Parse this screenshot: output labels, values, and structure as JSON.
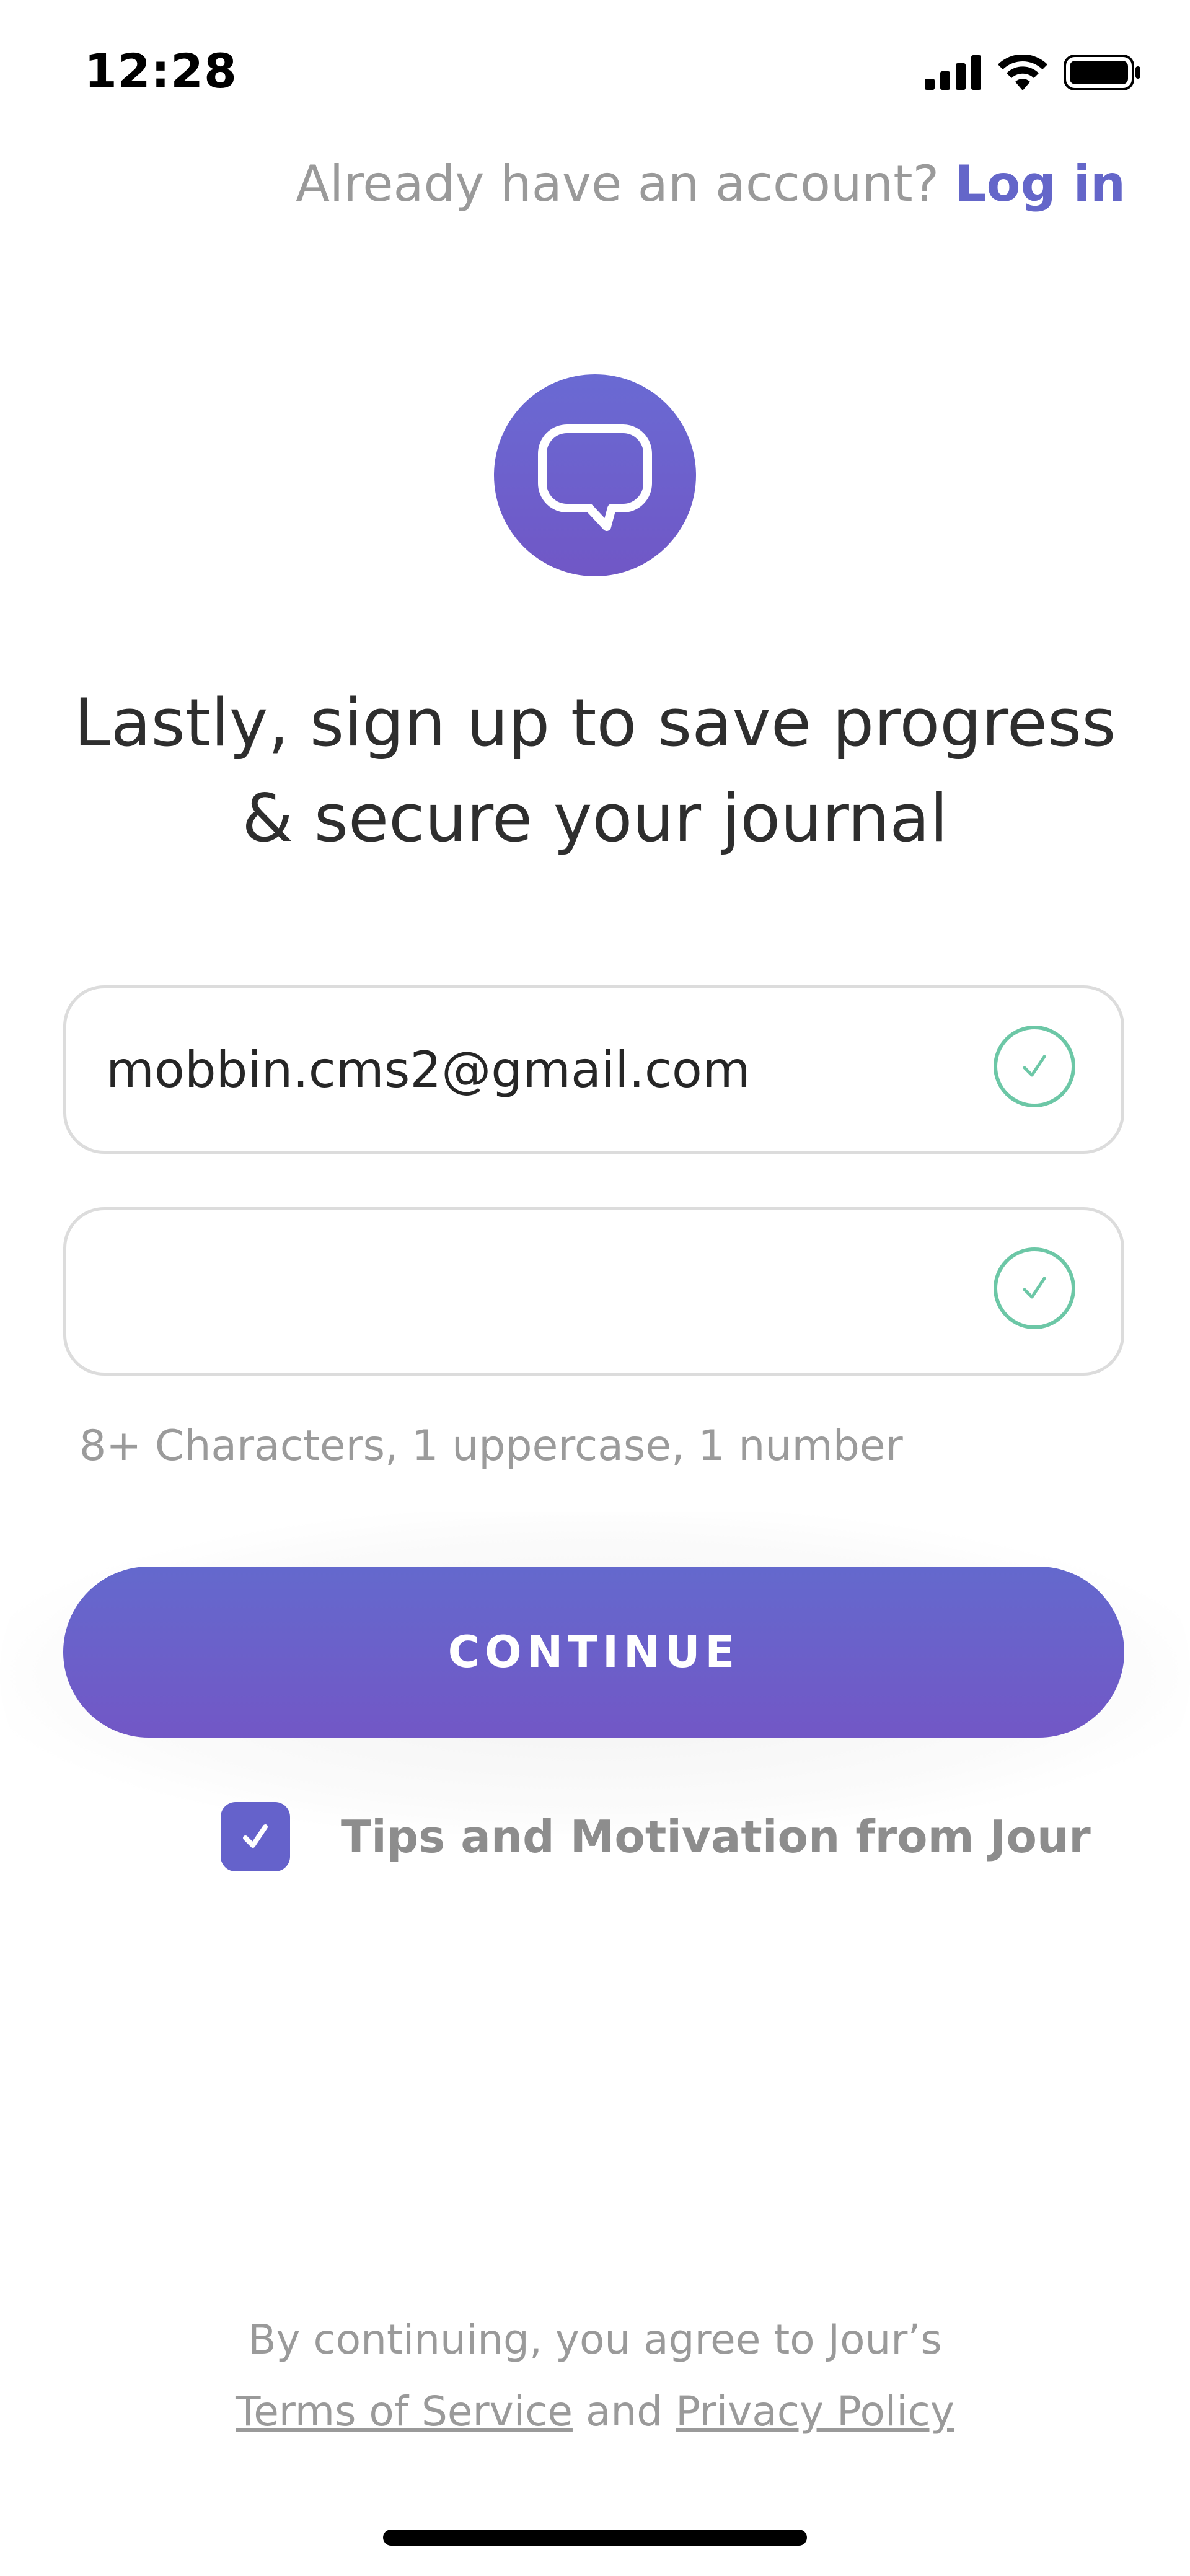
{
  "status_bar": {
    "time": "12:28",
    "icons": [
      "cellular-signal-icon",
      "wifi-icon",
      "battery-icon"
    ]
  },
  "header": {
    "login_prompt": "Already have an account?",
    "login_link": "Log in"
  },
  "logo": {
    "icon": "speech-bubble-icon",
    "gradient": [
      "#6a6ad3",
      "#7057c6"
    ]
  },
  "headline": {
    "line1": "Lastly, sign up to save progress",
    "line2": "& secure your journal"
  },
  "form": {
    "email": {
      "value": "mobbin.cms2@gmail.com",
      "status_icon": "valid-check-icon"
    },
    "password": {
      "value": "",
      "status_icon": "valid-check-icon"
    },
    "password_hint": "8+ Characters, 1 uppercase, 1 number"
  },
  "continue_button": {
    "label": "CONTINUE"
  },
  "newsletter": {
    "checked": true,
    "label": "Tips and Motivation from Jour"
  },
  "footer": {
    "line1": "By continuing, you agree to Jour’s",
    "terms": "Terms of Service",
    "and": "and",
    "privacy": "Privacy Policy"
  },
  "colors": {
    "accent": "#6466c9",
    "success": "#6cc7a6",
    "muted_text": "#9a9a9a"
  }
}
